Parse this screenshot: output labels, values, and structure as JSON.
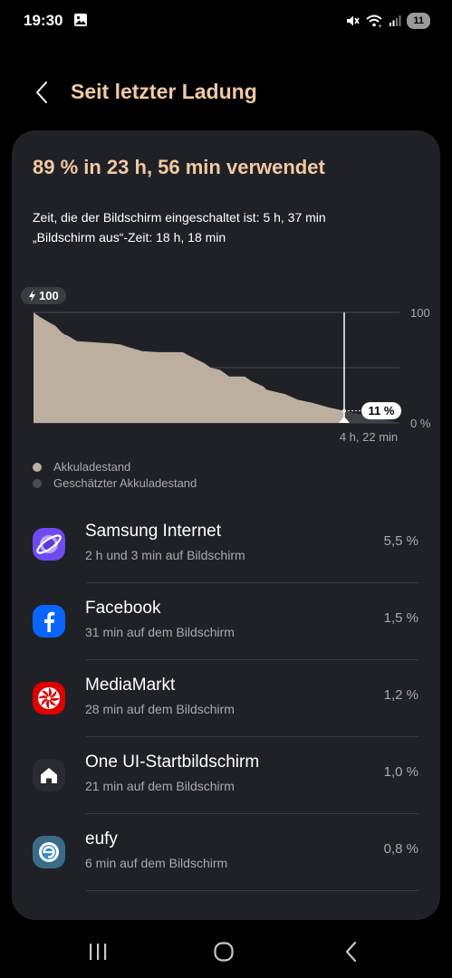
{
  "status_bar": {
    "time": "19:30",
    "battery_level": "11"
  },
  "header": {
    "title": "Seit letzter Ladung"
  },
  "summary": {
    "headline": "89 % in 23 h, 56 min verwendet",
    "screen_on": "Zeit, die der Bildschirm eingeschaltet ist: 5 h, 37 min",
    "screen_off": "„Bildschirm aus“-Zeit: 18 h, 18 min"
  },
  "chart_data": {
    "type": "area",
    "series": [
      {
        "name": "Akkuladestand",
        "x": [
          0,
          0.02,
          0.05,
          0.07,
          0.09,
          0.1,
          0.11,
          0.14,
          0.25,
          0.28,
          0.3,
          0.35,
          0.4,
          0.48,
          0.5,
          0.55,
          0.57,
          0.6,
          0.63,
          0.68,
          0.7,
          0.74,
          0.75,
          0.81,
          0.85,
          0.9,
          0.95,
          1.0
        ],
        "values": [
          100,
          96,
          91,
          88,
          82,
          80,
          79,
          74,
          72,
          71,
          69,
          65,
          64,
          64,
          61,
          54,
          50,
          48,
          42,
          42,
          38,
          33,
          30,
          26,
          21,
          18,
          14,
          11
        ]
      },
      {
        "name": "Geschätzter Akkuladestand",
        "values": [
          11,
          0
        ]
      }
    ],
    "start_badge": "100",
    "end_badge": "11 %",
    "ytick_top": "100",
    "ytick_bottom": "0 %",
    "remaining_label": "4 h, 22 min",
    "ylim": [
      0,
      100
    ],
    "grid": true,
    "colors": {
      "actual": "#bcaf9f",
      "estimate": "#3f4145",
      "grid": "#4a4c51"
    }
  },
  "legend": {
    "actual": "Akkuladestand",
    "estimate": "Geschätzter Akkuladestand"
  },
  "apps": [
    {
      "name": "Samsung Internet",
      "usage": "2 h und 3 min auf Bildschirm",
      "percent": "5,5 %",
      "icon": "samsung-internet-icon"
    },
    {
      "name": "Facebook",
      "usage": "31 min auf dem Bildschirm",
      "percent": "1,5 %",
      "icon": "facebook-icon"
    },
    {
      "name": "MediaMarkt",
      "usage": "28 min auf dem Bildschirm",
      "percent": "1,2 %",
      "icon": "mediamarkt-icon"
    },
    {
      "name": "One UI-Startbildschirm",
      "usage": "21 min auf dem Bildschirm",
      "percent": "1,0 %",
      "icon": "home-launcher-icon"
    },
    {
      "name": "eufy",
      "usage": "6 min auf dem Bildschirm",
      "percent": "0,8 %",
      "icon": "eufy-icon"
    }
  ]
}
